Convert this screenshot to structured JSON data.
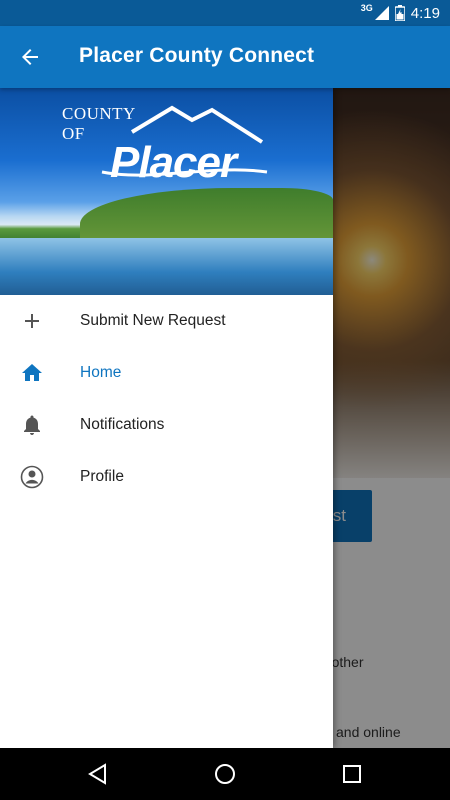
{
  "status_bar": {
    "network": "3G",
    "time": "4:19"
  },
  "app_bar": {
    "title": "Placer County Connect"
  },
  "drawer": {
    "logo_county": "COUNTY OF",
    "logo_name": "Placer",
    "items": [
      {
        "label": "Submit New Request",
        "icon": "plus-icon",
        "active": false
      },
      {
        "label": "Home",
        "icon": "home-icon",
        "active": true
      },
      {
        "label": "Notifications",
        "icon": "bell-icon",
        "active": false
      },
      {
        "label": "Profile",
        "icon": "account-icon",
        "active": false
      }
    ]
  },
  "background": {
    "button_fragment": "st",
    "text_fragment_1": "ut other",
    "text_fragment_2": "and online"
  },
  "colors": {
    "primary": "#0f75c0",
    "status_bar": "#0a5a97"
  }
}
